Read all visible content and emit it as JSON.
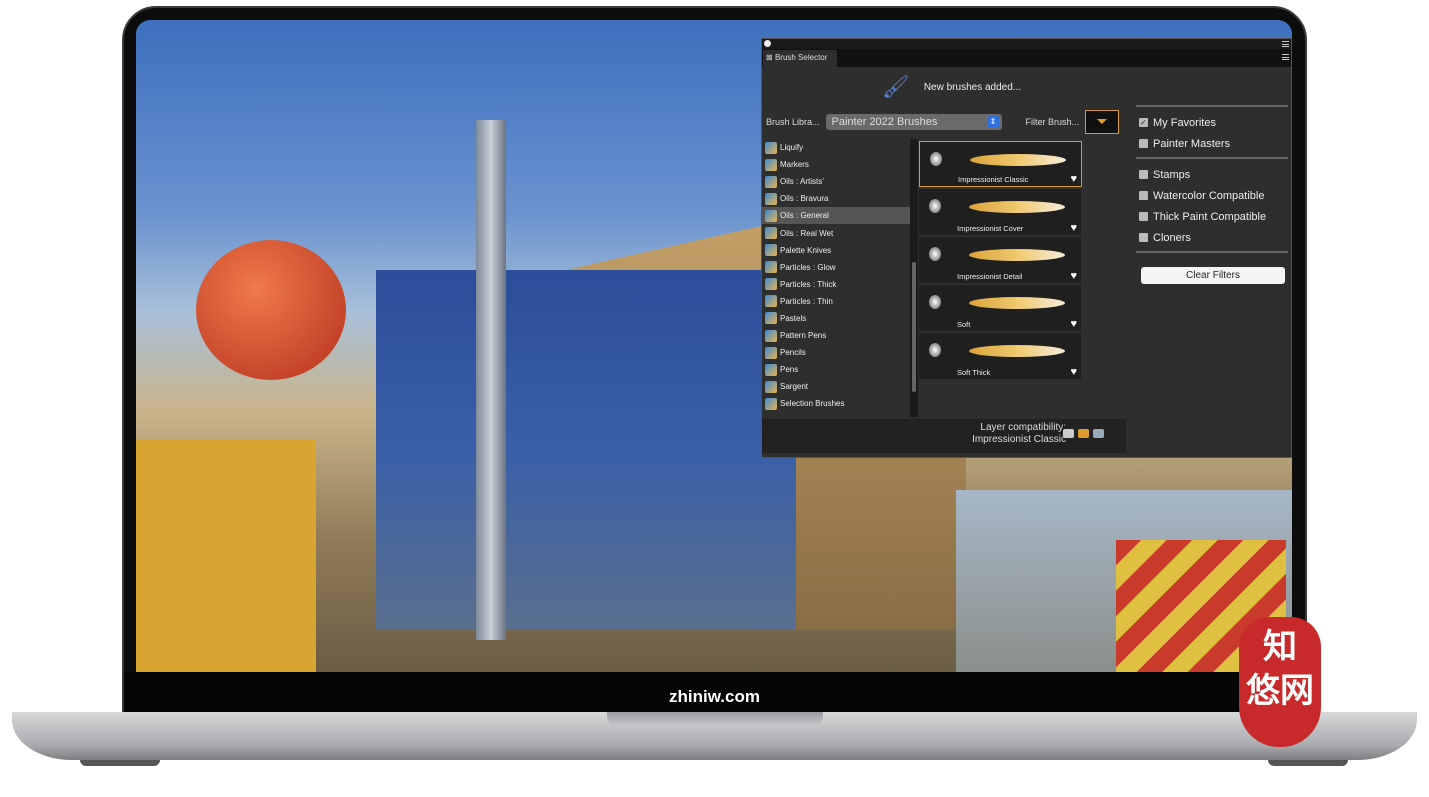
{
  "device": {
    "footer_text": "zhiniw.com"
  },
  "panel": {
    "title": "Brush Selector",
    "message": "New brushes added...",
    "library_label": "Brush Libra...",
    "library_value": "Painter 2022 Brushes",
    "filter_label": "Filter Brush...",
    "categories": [
      {
        "label": "Liquify"
      },
      {
        "label": "Markers"
      },
      {
        "label": "Oils : Artists'"
      },
      {
        "label": "Oils : Bravura"
      },
      {
        "label": "Oils : General",
        "selected": true
      },
      {
        "label": "Oils : Real Wet"
      },
      {
        "label": "Palette Knives"
      },
      {
        "label": "Particles : Glow"
      },
      {
        "label": "Particles : Thick"
      },
      {
        "label": "Particles : Thin"
      },
      {
        "label": "Pastels"
      },
      {
        "label": "Pattern Pens"
      },
      {
        "label": "Pencils"
      },
      {
        "label": "Pens"
      },
      {
        "label": "Sargent"
      },
      {
        "label": "Selection Brushes"
      }
    ],
    "brushes": [
      {
        "label": "Impressionist Classic",
        "selected": true
      },
      {
        "label": "Impressionist Cover"
      },
      {
        "label": "Impressionist Detail"
      },
      {
        "label": "Soft"
      },
      {
        "label": "Soft Thick"
      }
    ],
    "layer_compat_label": "Layer compatibility:",
    "layer_compat_value": "Impressionist Classic",
    "filters": [
      {
        "label": "My Favorites",
        "checked": true
      },
      {
        "label": "Painter Masters",
        "checked": false
      },
      {
        "label": "Stamps",
        "checked": false
      },
      {
        "label": "Watercolor Compatible",
        "checked": false
      },
      {
        "label": "Thick Paint Compatible",
        "checked": false
      },
      {
        "label": "Cloners",
        "checked": false
      }
    ],
    "clear_filters": "Clear Filters"
  },
  "watermark": {
    "seal_text": "知悠网"
  },
  "colors": {
    "accent": "#d49a2a",
    "panel_bg": "#2e2e2e",
    "selector_blue": "#2f6fe0"
  }
}
